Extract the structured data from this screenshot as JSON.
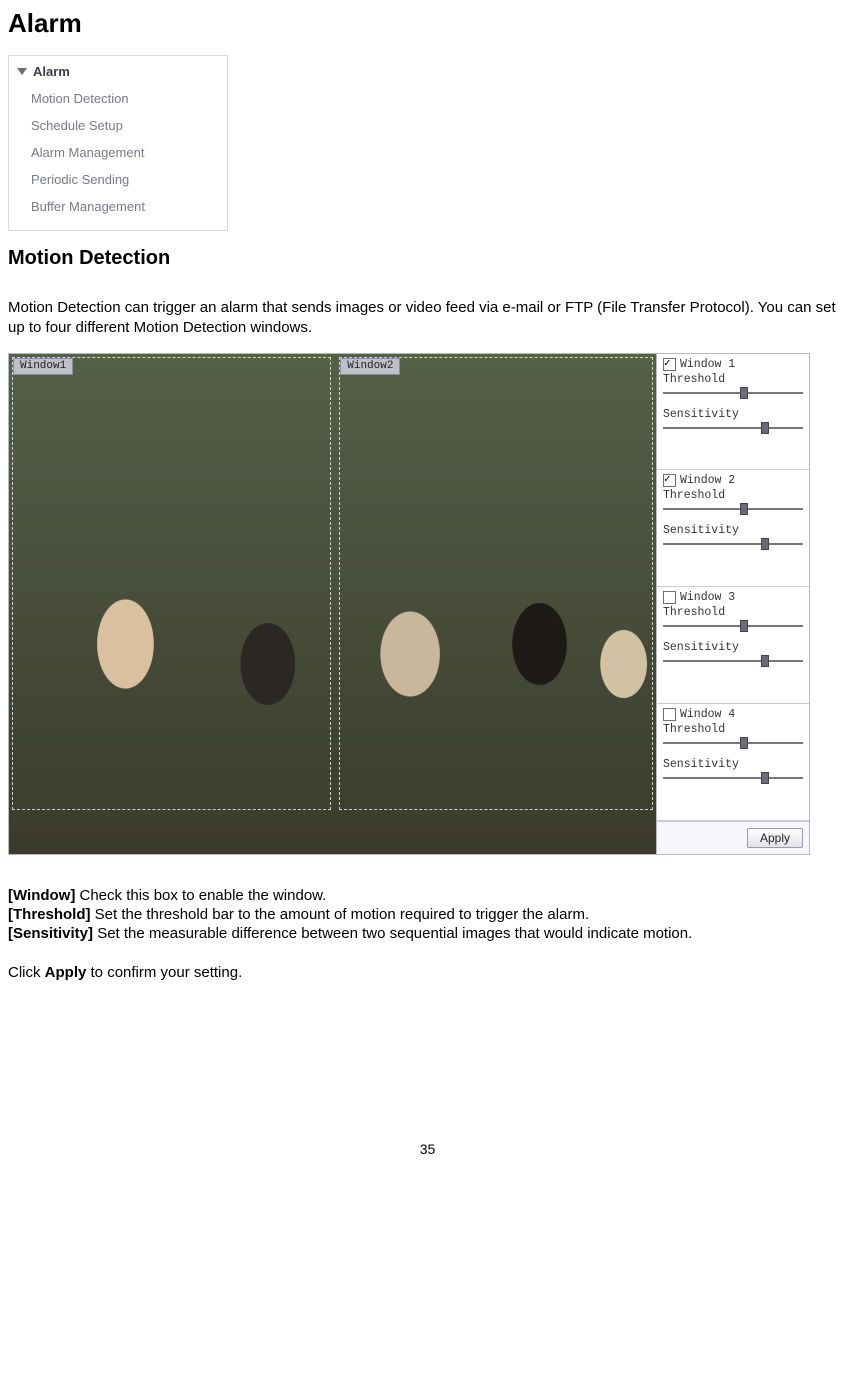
{
  "title": "Alarm",
  "nav": {
    "header": "Alarm",
    "items": [
      "Motion Detection",
      "Schedule Setup",
      "Alarm Management",
      "Periodic Sending",
      "Buffer Management"
    ]
  },
  "section_title": "Motion Detection",
  "intro": "Motion Detection can trigger an alarm that sends images or video feed via e-mail or FTP (File Transfer Protocol). You can set up to four different Motion Detection windows.",
  "md_ui": {
    "overlay_labels": [
      "Window1",
      "Window2"
    ],
    "windows": [
      {
        "label": "Window 1",
        "checked": true,
        "threshold_label": "Threshold",
        "sensitivity_label": "Sensitivity"
      },
      {
        "label": "Window 2",
        "checked": true,
        "threshold_label": "Threshold",
        "sensitivity_label": "Sensitivity"
      },
      {
        "label": "Window 3",
        "checked": false,
        "threshold_label": "Threshold",
        "sensitivity_label": "Sensitivity"
      },
      {
        "label": "Window 4",
        "checked": false,
        "threshold_label": "Threshold",
        "sensitivity_label": "Sensitivity"
      }
    ],
    "apply_label": "Apply"
  },
  "definitions": [
    {
      "key": "[Window]",
      "text": " Check this box to enable the window."
    },
    {
      "key": "[Threshold]",
      "text": " Set the threshold bar to the amount of motion required to trigger the alarm."
    },
    {
      "key": "[Sensitivity]",
      "text": " Set the measurable difference between two sequential images that would indicate motion."
    }
  ],
  "apply_line_prefix": "Click ",
  "apply_line_bold": "Apply",
  "apply_line_suffix": " to confirm your setting.",
  "page_number": "35"
}
